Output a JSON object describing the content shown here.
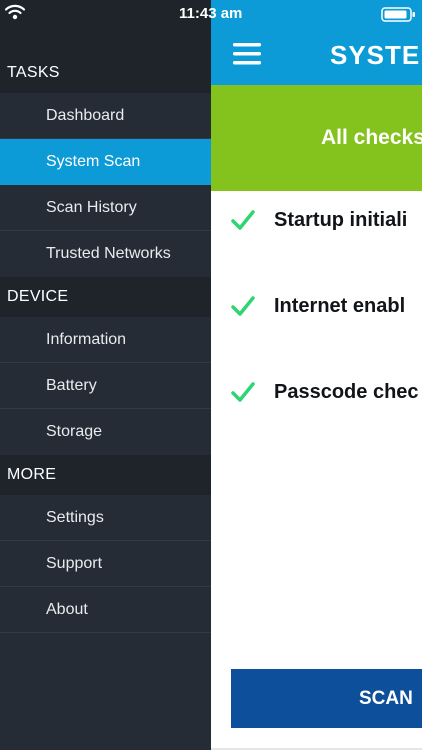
{
  "status_bar": {
    "time": "11:43 am"
  },
  "sidebar": {
    "sections": [
      {
        "title": "TASKS",
        "items": [
          "Dashboard",
          "System Scan",
          "Scan History",
          "Trusted Networks"
        ]
      },
      {
        "title": "DEVICE",
        "items": [
          "Information",
          "Battery",
          "Storage"
        ]
      },
      {
        "title": "MORE",
        "items": [
          "Settings",
          "Support",
          "About"
        ]
      }
    ],
    "active_item": "System Scan"
  },
  "header": {
    "title": "SYSTEM"
  },
  "result": {
    "text": "All checks"
  },
  "checks": [
    {
      "label": "Startup initiali",
      "status": "ok"
    },
    {
      "label": "Internet enabl",
      "status": "ok"
    },
    {
      "label": "Passcode chec",
      "status": "ok"
    }
  ],
  "scan_button": {
    "label": "SCAN"
  },
  "icons": {
    "wifi": "wifi-icon",
    "battery": "battery-icon",
    "menu": "hamburger-menu-icon",
    "check": "checkmark-icon"
  },
  "colors": {
    "sidebar_bg": "#262c35",
    "section_header_bg": "#1f242b",
    "accent_blue": "#0c9bd6",
    "success_green": "#84c21d",
    "check_green": "#2ed573",
    "button_blue": "#0d4f9a"
  }
}
